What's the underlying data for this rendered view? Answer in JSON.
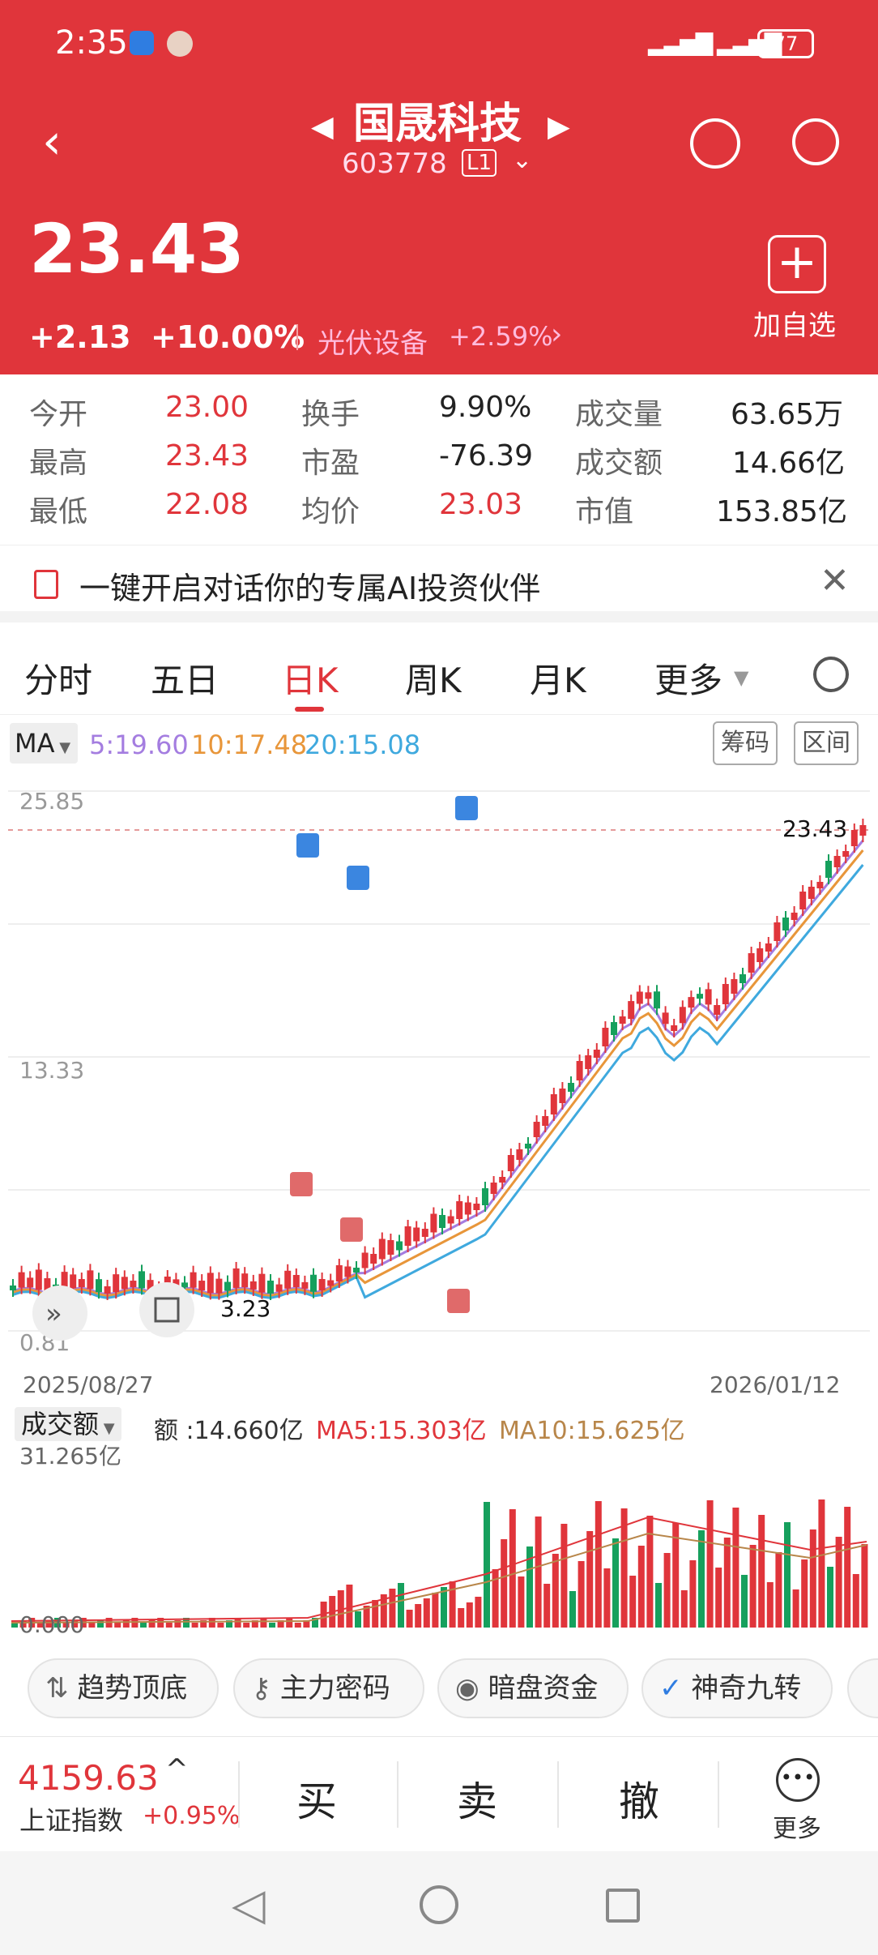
{
  "status_bar": {
    "time": "2:35",
    "battery": "77"
  },
  "header": {
    "title": "国晟科技",
    "code": "603778",
    "level": "L1",
    "price": "23.43",
    "change": "+2.13",
    "change_pct": "+10.00%",
    "sector": "光伏设备",
    "sector_pct": "+2.59%",
    "add_watch": "加自选"
  },
  "quote": {
    "rows": [
      [
        {
          "l": "今开",
          "v": "23.00"
        },
        {
          "l": "换手",
          "v": "9.90%"
        },
        {
          "l": "成交量",
          "v": "63.65万"
        }
      ],
      [
        {
          "l": "最高",
          "v": "23.43"
        },
        {
          "l": "市盈",
          "v": "-76.39"
        },
        {
          "l": "成交额",
          "v": "14.66亿"
        }
      ],
      [
        {
          "l": "最低",
          "v": "22.08"
        },
        {
          "l": "均价",
          "v": "23.03"
        },
        {
          "l": "市值",
          "v": "153.85亿"
        }
      ]
    ]
  },
  "ai_banner": {
    "text": "一键开启对话你的专属AI投资伙伴"
  },
  "tabs": [
    "分时",
    "五日",
    "日K",
    "周K",
    "月K",
    "更多"
  ],
  "active_tab": "日K",
  "ma": {
    "label": "MA",
    "ma5": "5:19.60",
    "ma10": "10:17.48",
    "ma20": "20:15.08",
    "chip_btn": "筹码",
    "range_btn": "区间"
  },
  "kline": {
    "y_top": "25.85",
    "y_mid": "13.33",
    "y_bottom": "0.81",
    "last_price": "23.43",
    "low_label": "3.23",
    "date_start": "2025/08/27",
    "date_end": "2026/01/12",
    "buy_marker": "B",
    "sell_marker": "S"
  },
  "volume": {
    "label": "成交额",
    "amount": "额 :14.660亿",
    "ma5": "MA5:15.303亿",
    "ma10": "MA10:15.625亿",
    "y_top": "31.265亿",
    "y_bottom": "0.000"
  },
  "features": [
    "趋势顶底",
    "主力密码",
    "暗盘资金",
    "神奇九转"
  ],
  "index": {
    "value": "4159.63",
    "name": "上证指数",
    "pct": "+0.95%"
  },
  "actions": {
    "buy": "买",
    "sell": "卖",
    "cancel": "撤",
    "more": "更多"
  },
  "colors": {
    "up": "#e0353b",
    "down": "#16a05d",
    "ma5": "#a47de0",
    "ma10": "#e8963a",
    "ma20": "#3fa9de"
  }
}
